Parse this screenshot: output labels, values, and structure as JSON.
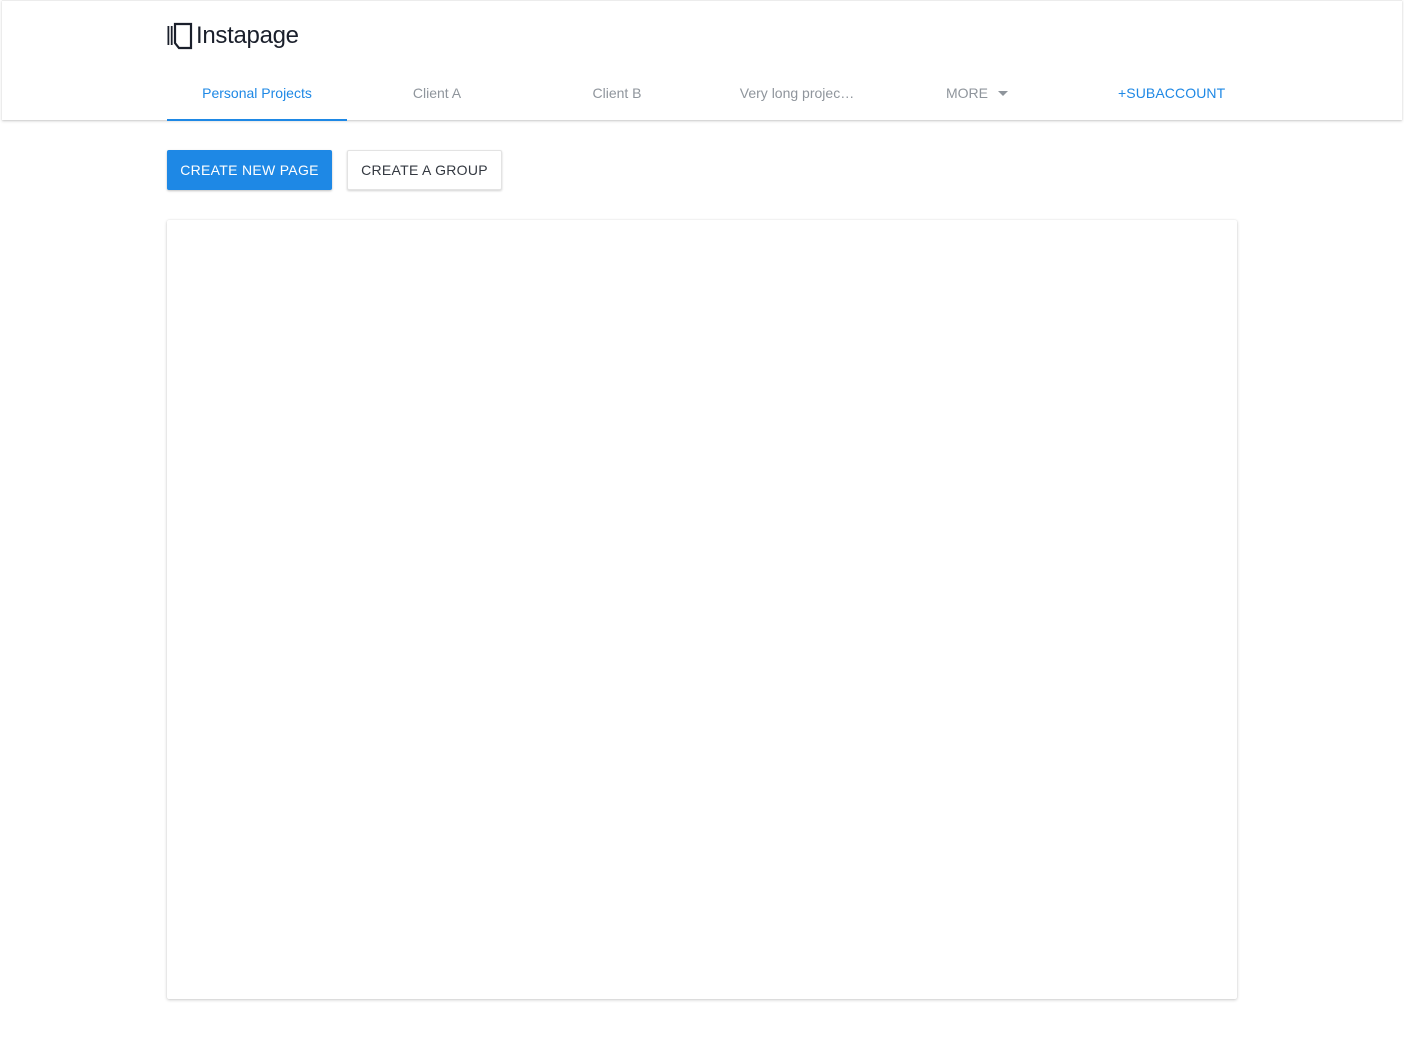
{
  "brand": {
    "logo_text": "Instapage",
    "logo_icon": "instapage-logo-icon",
    "text_color": "#1a1f2b"
  },
  "nav": {
    "tabs": [
      {
        "label": "Personal Projects",
        "active": true
      },
      {
        "label": "Client A",
        "active": false
      },
      {
        "label": "Client B",
        "active": false
      },
      {
        "label": "Very long projec…",
        "active": false
      },
      {
        "label": "MORE",
        "active": false,
        "icon": "caret-down-icon"
      }
    ],
    "subaccount_label": "+SUBACCOUNT"
  },
  "actions": {
    "create_page_label": "CREATE NEW PAGE",
    "create_group_label": "CREATE A GROUP"
  },
  "colors": {
    "accent": "#1e88e5",
    "inactive_tab": "#8f959c",
    "secondary_text": "#333840"
  }
}
